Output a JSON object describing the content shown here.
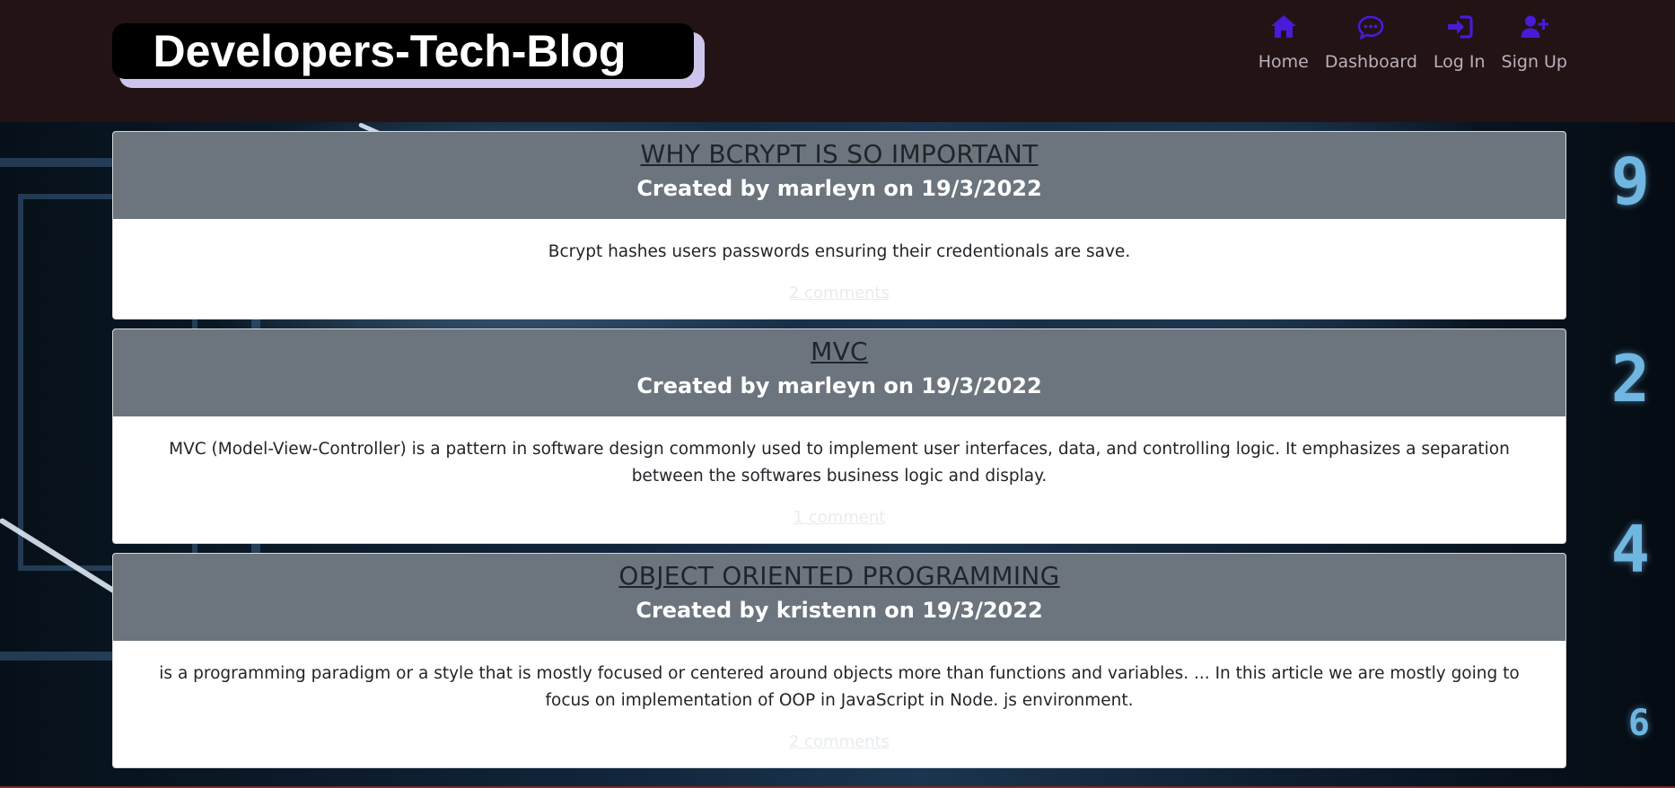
{
  "header": {
    "logo_text": "Developers-Tech-Blog",
    "nav": [
      {
        "label": "Home",
        "icon": "home-icon"
      },
      {
        "label": "Dashboard",
        "icon": "chat-bubble-icon"
      },
      {
        "label": "Log In",
        "icon": "sign-in-icon"
      },
      {
        "label": "Sign Up",
        "icon": "user-plus-icon"
      }
    ]
  },
  "background": {
    "digits": [
      "9",
      "2",
      "4",
      "6"
    ]
  },
  "posts": [
    {
      "title": "WHY BCRYPT IS SO IMPORTANT",
      "meta": "Created by marleyn on 19/3/2022",
      "body": "Bcrypt hashes users passwords ensuring their credentionals are save.",
      "comments": "2 comments"
    },
    {
      "title": "MVC",
      "meta": "Created by marleyn on 19/3/2022",
      "body": "MVC (Model-View-Controller) is a pattern in software design commonly used to implement user interfaces, data, and controlling logic. It emphasizes a separation between the softwares business logic and display.",
      "comments": "1 comment"
    },
    {
      "title": "OBJECT ORIENTED PROGRAMMING",
      "meta": "Created by kristenn on 19/3/2022",
      "body": "is a programming paradigm or a style that is mostly focused or centered around objects more than functions and variables. ... In this article we are mostly going to focus on implementation of OOP in JavaScript in Node. js environment.",
      "comments": "2 comments"
    }
  ],
  "colors": {
    "header_bg": "#231314",
    "nav_icon": "#4a1ad9",
    "card_header": "#6c757d"
  }
}
